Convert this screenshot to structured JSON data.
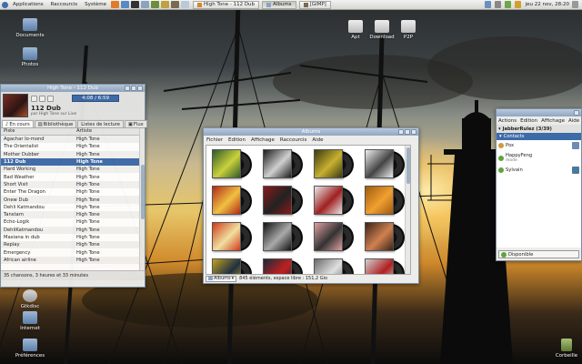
{
  "top_panel": {
    "menus": [
      "Applications",
      "Raccourcis",
      "Système"
    ],
    "tasks": [
      {
        "label": "High Tone - 112 Dub",
        "active": false
      },
      {
        "label": "Albums",
        "active": true
      },
      {
        "label": "[GIMP]",
        "active": false
      }
    ],
    "clock": "jeu 22 nov, 28:20"
  },
  "desktop_icons": [
    "Documents",
    "Photos",
    "Apt",
    "Download",
    "P2P",
    "Gtkdisc",
    "Internet",
    "Préférences",
    "Corbeille"
  ],
  "music_player": {
    "time": "4:08 / 6:59",
    "track_title": "112 Dub",
    "track_subtitle": "par High Tone sur Live",
    "tabs": [
      "En cours",
      "Bibliothèque",
      "Listes de lecture",
      "Flux"
    ],
    "columns": [
      "Piste",
      "Artiste"
    ],
    "rows": [
      [
        "Agachar Io-mond",
        "High Tone"
      ],
      [
        "The Orientalist",
        "High Tone"
      ],
      [
        "Mother Dubber",
        "High Tone"
      ],
      [
        "112 Dub",
        "High Tone"
      ],
      [
        "Hard Working",
        "High Tone"
      ],
      [
        "Bad Weather",
        "High Tone"
      ],
      [
        "Short Visit",
        "High Tone"
      ],
      [
        "Enter The Dragon",
        "High Tone"
      ],
      [
        "Onew Dub",
        "High Tone"
      ],
      [
        "Dehli Katmandou",
        "High Tone"
      ],
      [
        "Tanstarn",
        "High Tone"
      ],
      [
        "Echo-Logik",
        "High Tone"
      ],
      [
        "DehliKatmandou",
        "High Tone"
      ],
      [
        "Maxiana in dub",
        "High Tone"
      ],
      [
        "Replay",
        "High Tone"
      ],
      [
        "Emergency",
        "High Tone"
      ],
      [
        "African airline",
        "High Tone"
      ]
    ],
    "selected_index": 3,
    "status": "35 chansons, 3 heures et 33 minutes"
  },
  "albums": {
    "title": "Albums",
    "menu": [
      "Fichier",
      "Edition",
      "Affichage",
      "Raccourcis",
      "Aide"
    ],
    "view": "Albums",
    "status": "845 éléments, espace libre : 151,2 Gio"
  },
  "contacts": {
    "menu": [
      "Actions",
      "Edition",
      "Affichage",
      "Aide"
    ],
    "account": "JabberRulez (3/39)",
    "group": "Contacts",
    "list": [
      {
        "name": "Pox",
        "status": ""
      },
      {
        "name": "HappyFeng",
        "status": "mode"
      },
      {
        "name": "Sylvain",
        "status": ""
      }
    ],
    "presence": "Disponible"
  }
}
